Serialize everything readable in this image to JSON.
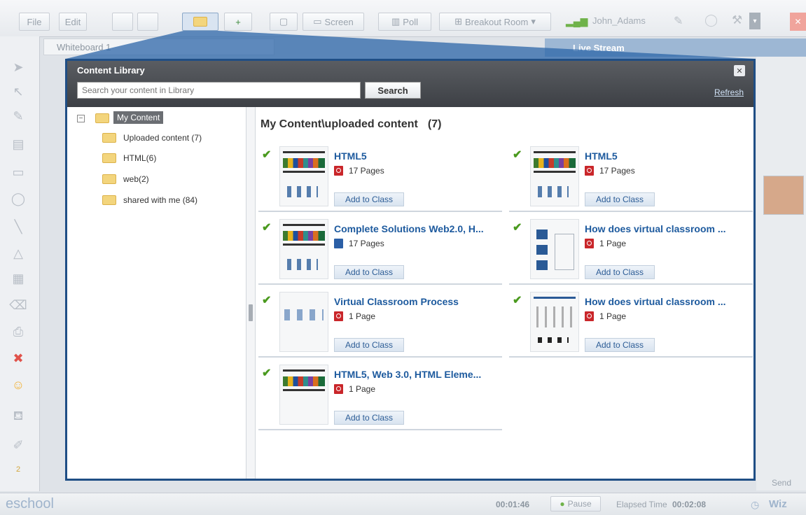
{
  "toolbar": {
    "file": "File",
    "edit": "Edit",
    "screen": "Screen",
    "poll": "Poll",
    "breakout": "Breakout Room",
    "user": "John_Adams"
  },
  "whiteboard": {
    "tab": "Whiteboard 1"
  },
  "live_stream": {
    "label": "Live Stream"
  },
  "modal": {
    "title": "Content Library",
    "search_placeholder": "Search your content in Library",
    "search_button": "Search",
    "refresh": "Refresh",
    "tree": {
      "root": "My Content",
      "items": [
        {
          "label": "Uploaded content (7)"
        },
        {
          "label": "HTML(6)"
        },
        {
          "label": "web(2)"
        },
        {
          "label": "shared with me (84)"
        }
      ]
    },
    "path_title": "My Content\\uploaded content",
    "count": "(7)",
    "add_label": "Add to Class",
    "items": [
      {
        "title": "HTML5",
        "pages": "17  Pages",
        "icon": "pdf-icon"
      },
      {
        "title": "HTML5",
        "pages": "17  Pages",
        "icon": "pdf-icon"
      },
      {
        "title": "Complete Solutions Web2.0, H...",
        "pages": "17  Pages",
        "icon": "doc-icon"
      },
      {
        "title": "How does virtual classroom ...",
        "pages": "1  Page",
        "icon": "pdf-icon"
      },
      {
        "title": "Virtual Classroom Process",
        "pages": "1  Page",
        "icon": "pdf-icon"
      },
      {
        "title": "How does virtual classroom ...",
        "pages": "1  Page",
        "icon": "pdf-icon"
      },
      {
        "title": "HTML5, Web 3.0, HTML Eleme...",
        "pages": "1  Page",
        "icon": "pdf-icon"
      }
    ]
  },
  "status": {
    "logo": "eschool",
    "timer": "00:01:46",
    "pause": "Pause",
    "elapsed_label": "Elapsed Time",
    "elapsed_value": "00:02:08",
    "right": "Wiz",
    "send": "Send"
  },
  "colors": {
    "accent": "#1f4e85",
    "link": "#1d5a9e",
    "check": "#4a9a1e"
  }
}
